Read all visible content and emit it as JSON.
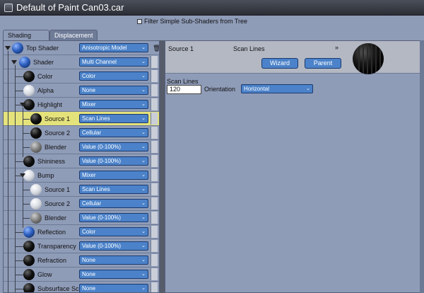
{
  "window": {
    "title": "Default of Paint Can03.car"
  },
  "filter": {
    "label": "Filter Simple Sub-Shaders from Tree"
  },
  "tabs": [
    {
      "label": "Shading"
    },
    {
      "label": "Displacement"
    }
  ],
  "tree": {
    "rows": [
      {
        "label": "Top Shader",
        "value": "Anisotropic Model",
        "ball": "blue"
      },
      {
        "label": "Shader",
        "value": "Multi Channel",
        "ball": "blue"
      },
      {
        "label": "Color",
        "value": "Color",
        "ball": "black"
      },
      {
        "label": "Alpha",
        "value": "None",
        "ball": "white"
      },
      {
        "label": "Highlight",
        "value": "Mixer",
        "ball": "black"
      },
      {
        "label": "Source 1",
        "value": "Scan Lines",
        "ball": "black"
      },
      {
        "label": "Source 2",
        "value": "Cellular",
        "ball": "black"
      },
      {
        "label": "Blender",
        "value": "Value (0-100%)",
        "ball": "gray"
      },
      {
        "label": "Shininess",
        "value": "Value (0-100%)",
        "ball": "black"
      },
      {
        "label": "Bump",
        "value": "Mixer",
        "ball": "white"
      },
      {
        "label": "Source 1",
        "value": "Scan Lines",
        "ball": "white"
      },
      {
        "label": "Source 2",
        "value": "Cellular",
        "ball": "white"
      },
      {
        "label": "Blender",
        "value": "Value (0-100%)",
        "ball": "gray"
      },
      {
        "label": "Reflection",
        "value": "Color",
        "ball": "blue"
      },
      {
        "label": "Transparency",
        "value": "Value (0-100%)",
        "ball": "black"
      },
      {
        "label": "Refraction",
        "value": "None",
        "ball": "black"
      },
      {
        "label": "Glow",
        "value": "None",
        "ball": "black"
      },
      {
        "label": "Subsurface Sc",
        "value": "None",
        "ball": "black"
      }
    ]
  },
  "panel": {
    "source_label": "Source 1",
    "shader_name": "Scan Lines",
    "chevron": "»",
    "wizard_label": "Wizard",
    "parent_label": "Parent",
    "scan_lines_label": "Scan Lines",
    "scan_lines_value": "120",
    "orientation_label": "Orientation",
    "orientation_value": "Horizontal"
  },
  "colors": {
    "accent": "#4b82c9",
    "highlight_row": "#e4e27b",
    "background": "#8f9cb8"
  }
}
